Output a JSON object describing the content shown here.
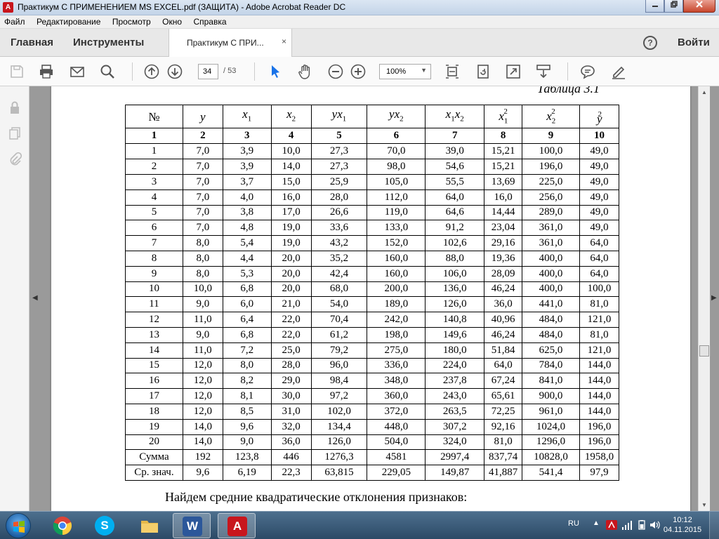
{
  "window": {
    "title": "Практикум С ПРИМЕНЕНИЕМ MS EXCEL.pdf (ЗАЩИТА) - Adobe Acrobat Reader DC",
    "app_icon": "A"
  },
  "menu": [
    "Файл",
    "Редактирование",
    "Просмотр",
    "Окно",
    "Справка"
  ],
  "tabs": {
    "home": "Главная",
    "tools": "Инструменты",
    "document": "Практикум С ПРИ...",
    "close": "×",
    "help": "?",
    "signin": "Войти"
  },
  "toolbar": {
    "page_current": "34",
    "page_total": "/ 53",
    "zoom": "100%"
  },
  "document": {
    "table_caption": "Таблица 3.1",
    "columns": [
      {
        "base": "№"
      },
      {
        "base": "y"
      },
      {
        "base": "x",
        "sub": "1"
      },
      {
        "base": "x",
        "sub": "2"
      },
      {
        "base": "yx",
        "sub": "1"
      },
      {
        "base": "yx",
        "sub": "2"
      },
      {
        "base": "x",
        "sub": "1",
        "base2": "x",
        "sub2": "2"
      },
      {
        "base": "x",
        "sub": "1",
        "sup": "2"
      },
      {
        "base": "x",
        "sub": "2",
        "sup": "2"
      },
      {
        "base": "y",
        "sup": "2"
      }
    ],
    "col_index": [
      "1",
      "2",
      "3",
      "4",
      "5",
      "6",
      "7",
      "8",
      "9",
      "10"
    ],
    "rows": [
      [
        "1",
        "7,0",
        "3,9",
        "10,0",
        "27,3",
        "70,0",
        "39,0",
        "15,21",
        "100,0",
        "49,0"
      ],
      [
        "2",
        "7,0",
        "3,9",
        "14,0",
        "27,3",
        "98,0",
        "54,6",
        "15,21",
        "196,0",
        "49,0"
      ],
      [
        "3",
        "7,0",
        "3,7",
        "15,0",
        "25,9",
        "105,0",
        "55,5",
        "13,69",
        "225,0",
        "49,0"
      ],
      [
        "4",
        "7,0",
        "4,0",
        "16,0",
        "28,0",
        "112,0",
        "64,0",
        "16,0",
        "256,0",
        "49,0"
      ],
      [
        "5",
        "7,0",
        "3,8",
        "17,0",
        "26,6",
        "119,0",
        "64,6",
        "14,44",
        "289,0",
        "49,0"
      ],
      [
        "6",
        "7,0",
        "4,8",
        "19,0",
        "33,6",
        "133,0",
        "91,2",
        "23,04",
        "361,0",
        "49,0"
      ],
      [
        "7",
        "8,0",
        "5,4",
        "19,0",
        "43,2",
        "152,0",
        "102,6",
        "29,16",
        "361,0",
        "64,0"
      ],
      [
        "8",
        "8,0",
        "4,4",
        "20,0",
        "35,2",
        "160,0",
        "88,0",
        "19,36",
        "400,0",
        "64,0"
      ],
      [
        "9",
        "8,0",
        "5,3",
        "20,0",
        "42,4",
        "160,0",
        "106,0",
        "28,09",
        "400,0",
        "64,0"
      ],
      [
        "10",
        "10,0",
        "6,8",
        "20,0",
        "68,0",
        "200,0",
        "136,0",
        "46,24",
        "400,0",
        "100,0"
      ],
      [
        "11",
        "9,0",
        "6,0",
        "21,0",
        "54,0",
        "189,0",
        "126,0",
        "36,0",
        "441,0",
        "81,0"
      ],
      [
        "12",
        "11,0",
        "6,4",
        "22,0",
        "70,4",
        "242,0",
        "140,8",
        "40,96",
        "484,0",
        "121,0"
      ],
      [
        "13",
        "9,0",
        "6,8",
        "22,0",
        "61,2",
        "198,0",
        "149,6",
        "46,24",
        "484,0",
        "81,0"
      ],
      [
        "14",
        "11,0",
        "7,2",
        "25,0",
        "79,2",
        "275,0",
        "180,0",
        "51,84",
        "625,0",
        "121,0"
      ],
      [
        "15",
        "12,0",
        "8,0",
        "28,0",
        "96,0",
        "336,0",
        "224,0",
        "64,0",
        "784,0",
        "144,0"
      ],
      [
        "16",
        "12,0",
        "8,2",
        "29,0",
        "98,4",
        "348,0",
        "237,8",
        "67,24",
        "841,0",
        "144,0"
      ],
      [
        "17",
        "12,0",
        "8,1",
        "30,0",
        "97,2",
        "360,0",
        "243,0",
        "65,61",
        "900,0",
        "144,0"
      ],
      [
        "18",
        "12,0",
        "8,5",
        "31,0",
        "102,0",
        "372,0",
        "263,5",
        "72,25",
        "961,0",
        "144,0"
      ],
      [
        "19",
        "14,0",
        "9,6",
        "32,0",
        "134,4",
        "448,0",
        "307,2",
        "92,16",
        "1024,0",
        "196,0"
      ],
      [
        "20",
        "14,0",
        "9,0",
        "36,0",
        "126,0",
        "504,0",
        "324,0",
        "81,0",
        "1296,0",
        "196,0"
      ],
      [
        "Сумма",
        "192",
        "123,8",
        "446",
        "1276,3",
        "4581",
        "2997,4",
        "837,74",
        "10828,0",
        "1958,0"
      ],
      [
        "Ср. знач.",
        "9,6",
        "6,19",
        "22,3",
        "63,815",
        "229,05",
        "149,87",
        "41,887",
        "541,4",
        "97,9"
      ]
    ],
    "following_text": "Найдем средние квадратические отклонения признаков:"
  },
  "taskbar": {
    "apps": [
      {
        "name": "chrome",
        "glyph": ""
      },
      {
        "name": "skype",
        "glyph": "S"
      },
      {
        "name": "explorer",
        "glyph": ""
      },
      {
        "name": "word",
        "glyph": "W"
      },
      {
        "name": "acrobat",
        "glyph": "A"
      }
    ],
    "lang": "RU",
    "time": "10:12",
    "date": "04.11.2015"
  },
  "colors": {
    "acrobat_red": "#c8161d",
    "taskbar": "#2c4a66"
  }
}
